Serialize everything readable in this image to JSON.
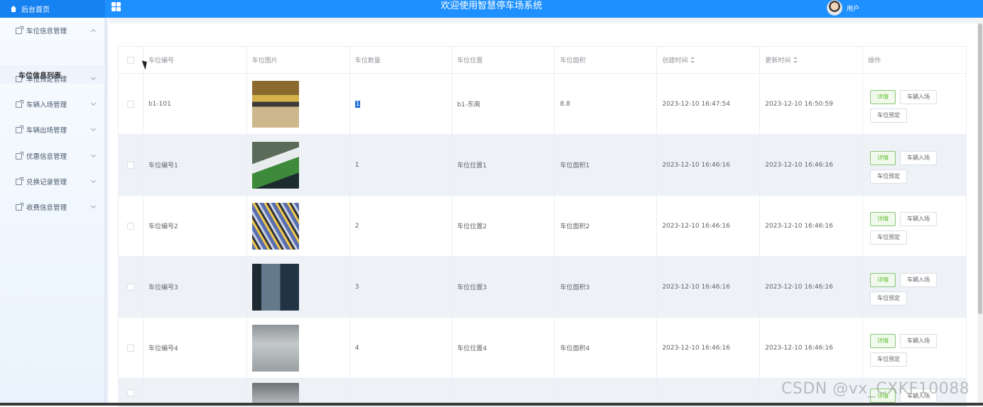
{
  "header": {
    "home_label": "后台首页",
    "title": "欢迎使用智慧停车场系统",
    "user_label": "用户"
  },
  "sidebar": {
    "items": [
      {
        "label": "车位信息管理",
        "expanded": true
      },
      {
        "label": "车位预定管理"
      },
      {
        "label": "车辆入场管理"
      },
      {
        "label": "车辆出场管理"
      },
      {
        "label": "优惠信息管理"
      },
      {
        "label": "兑换记录管理"
      },
      {
        "label": "收费信息管理"
      }
    ],
    "sub_item": "车位信息列表"
  },
  "table": {
    "columns": [
      "车位编号",
      "车位图片",
      "车位数量",
      "车位位置",
      "车位面积",
      "创建时间",
      "更新时间",
      "操作"
    ],
    "rows": [
      {
        "code": "b1-101",
        "qty": "1",
        "location": "b1-东南",
        "area": "8.8",
        "created": "2023-12-10 16:47:54",
        "updated": "2023-12-10 16:50:59"
      },
      {
        "code": "车位编号1",
        "qty": "1",
        "location": "车位位置1",
        "area": "车位面积1",
        "created": "2023-12-10 16:46:16",
        "updated": "2023-12-10 16:46:16"
      },
      {
        "code": "车位编号2",
        "qty": "2",
        "location": "车位位置2",
        "area": "车位面积2",
        "created": "2023-12-10 16:46:16",
        "updated": "2023-12-10 16:46:16"
      },
      {
        "code": "车位编号3",
        "qty": "3",
        "location": "车位位置3",
        "area": "车位面积3",
        "created": "2023-12-10 16:46:16",
        "updated": "2023-12-10 16:46:16"
      },
      {
        "code": "车位编号4",
        "qty": "4",
        "location": "车位位置4",
        "area": "车位面积4",
        "created": "2023-12-10 16:46:16",
        "updated": "2023-12-10 16:46:16"
      }
    ],
    "actions": {
      "detail": "详情",
      "entry": "车辆入场",
      "reserve": "车位预定"
    }
  },
  "watermark": "CSDN @vx_CXKF10088"
}
